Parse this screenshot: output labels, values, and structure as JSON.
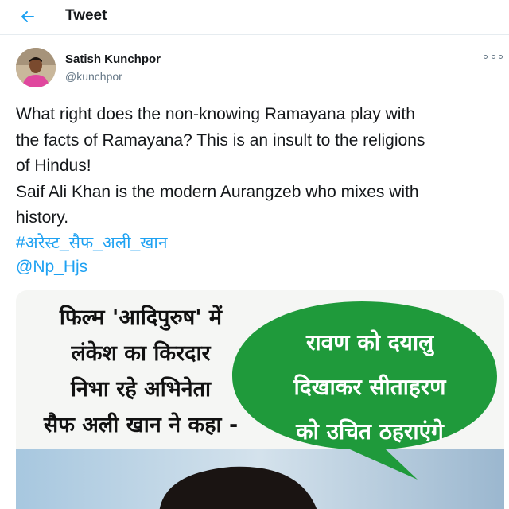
{
  "header": {
    "title": "Tweet",
    "back_icon": "arrow-left-icon",
    "accent_color": "#1da1f2"
  },
  "author": {
    "name": "Satish Kunchpor",
    "handle": "@kunchpor"
  },
  "tweet": {
    "text_lines": [
      "What right does the non-knowing Ramayana play with",
      "the facts of Ramayana? This is an insult to the religions",
      "of Hindus!",
      "Saif Ali Khan is the modern Aurangzeb who mixes with",
      "history."
    ],
    "hashtag": "#अरेस्ट_सैफ_अली_खान",
    "mention": "@Np_Hjs",
    "more_icon": "more-options-icon"
  },
  "media": {
    "left_caption_lines": [
      "फिल्म 'आदिपुरुष' में",
      "लंकेश का किरदार",
      "निभा रहे अभिनेता",
      "सैफ अली खान ने कहा -"
    ],
    "bubble_lines": [
      "रावण को दयालु",
      "दिखाकर सीताहरण",
      "को उचित ठहराएंगे"
    ],
    "bubble_color": "#1f9a3b"
  }
}
